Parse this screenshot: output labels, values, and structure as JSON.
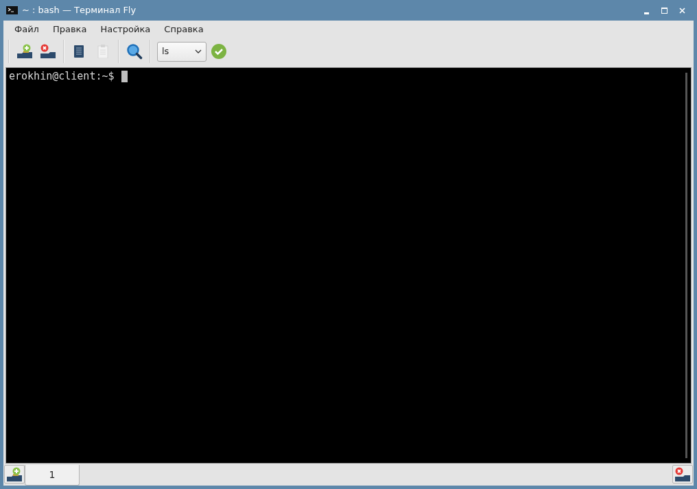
{
  "window": {
    "title": "~ : bash — Терминал Fly"
  },
  "menu": [
    "Файл",
    "Правка",
    "Настройка",
    "Справка"
  ],
  "toolbar": {
    "command": {
      "value": "ls"
    }
  },
  "terminal": {
    "prompt": "erokhin@client:~$"
  },
  "tabs": [
    {
      "label": "1",
      "selected": true
    }
  ]
}
